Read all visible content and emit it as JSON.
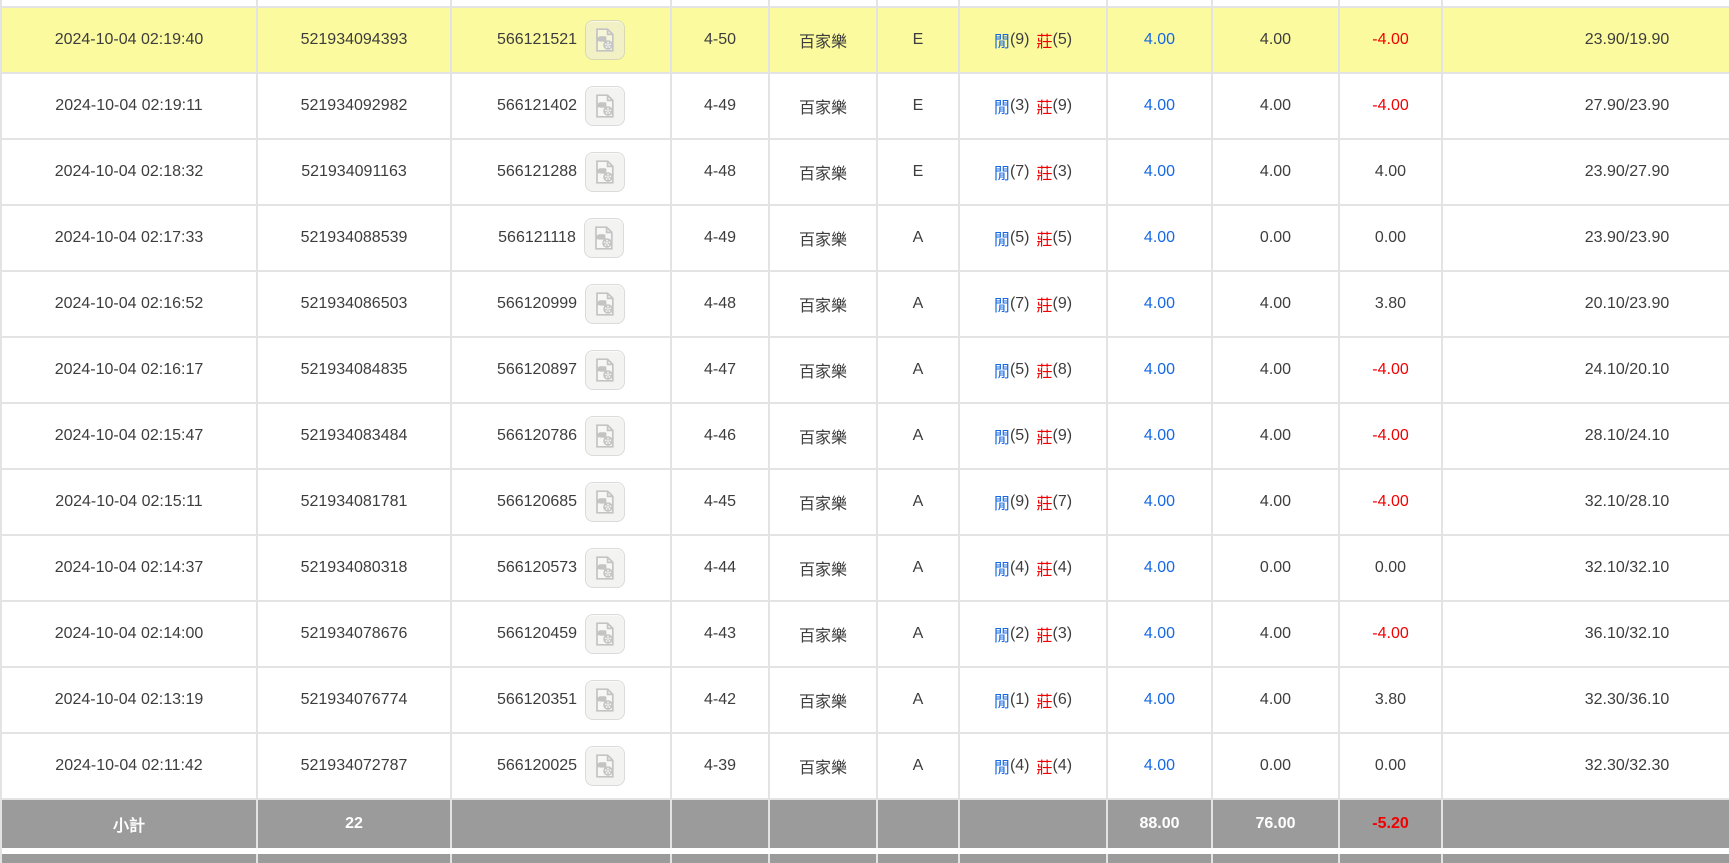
{
  "colors": {
    "highlight_row": "#fbfa9e",
    "summary_bar": "#9b9b9b",
    "bet_amount_blue": "#1668e3",
    "negative_red": "#f20000",
    "grid_border": "#e3e3e3",
    "text": "#3d3d3d"
  },
  "labels": {
    "player": "閒",
    "banker": "莊",
    "game_baccarat": "百家樂",
    "video_icon": "video-replay-icon"
  },
  "table": {
    "rows": [
      {
        "time": "2024-10-04 02:19:40",
        "bet_id": "521934094393",
        "game_id": "566121521",
        "round": "4-50",
        "game": "百家樂",
        "table": "E",
        "player_score": "(9)",
        "banker_score": "(5)",
        "bet": "4.00",
        "valid": "4.00",
        "win_loss": "-4.00",
        "balance": "23.90/19.90",
        "highlight": true
      },
      {
        "time": "2024-10-04 02:19:11",
        "bet_id": "521934092982",
        "game_id": "566121402",
        "round": "4-49",
        "game": "百家樂",
        "table": "E",
        "player_score": "(3)",
        "banker_score": "(9)",
        "bet": "4.00",
        "valid": "4.00",
        "win_loss": "-4.00",
        "balance": "27.90/23.90",
        "highlight": false
      },
      {
        "time": "2024-10-04 02:18:32",
        "bet_id": "521934091163",
        "game_id": "566121288",
        "round": "4-48",
        "game": "百家樂",
        "table": "E",
        "player_score": "(7)",
        "banker_score": "(3)",
        "bet": "4.00",
        "valid": "4.00",
        "win_loss": "4.00",
        "balance": "23.90/27.90",
        "highlight": false
      },
      {
        "time": "2024-10-04 02:17:33",
        "bet_id": "521934088539",
        "game_id": "566121118",
        "round": "4-49",
        "game": "百家樂",
        "table": "A",
        "player_score": "(5)",
        "banker_score": "(5)",
        "bet": "4.00",
        "valid": "0.00",
        "win_loss": "0.00",
        "balance": "23.90/23.90",
        "highlight": false
      },
      {
        "time": "2024-10-04 02:16:52",
        "bet_id": "521934086503",
        "game_id": "566120999",
        "round": "4-48",
        "game": "百家樂",
        "table": "A",
        "player_score": "(7)",
        "banker_score": "(9)",
        "bet": "4.00",
        "valid": "4.00",
        "win_loss": "3.80",
        "balance": "20.10/23.90",
        "highlight": false
      },
      {
        "time": "2024-10-04 02:16:17",
        "bet_id": "521934084835",
        "game_id": "566120897",
        "round": "4-47",
        "game": "百家樂",
        "table": "A",
        "player_score": "(5)",
        "banker_score": "(8)",
        "bet": "4.00",
        "valid": "4.00",
        "win_loss": "-4.00",
        "balance": "24.10/20.10",
        "highlight": false
      },
      {
        "time": "2024-10-04 02:15:47",
        "bet_id": "521934083484",
        "game_id": "566120786",
        "round": "4-46",
        "game": "百家樂",
        "table": "A",
        "player_score": "(5)",
        "banker_score": "(9)",
        "bet": "4.00",
        "valid": "4.00",
        "win_loss": "-4.00",
        "balance": "28.10/24.10",
        "highlight": false
      },
      {
        "time": "2024-10-04 02:15:11",
        "bet_id": "521934081781",
        "game_id": "566120685",
        "round": "4-45",
        "game": "百家樂",
        "table": "A",
        "player_score": "(9)",
        "banker_score": "(7)",
        "bet": "4.00",
        "valid": "4.00",
        "win_loss": "-4.00",
        "balance": "32.10/28.10",
        "highlight": false
      },
      {
        "time": "2024-10-04 02:14:37",
        "bet_id": "521934080318",
        "game_id": "566120573",
        "round": "4-44",
        "game": "百家樂",
        "table": "A",
        "player_score": "(4)",
        "banker_score": "(4)",
        "bet": "4.00",
        "valid": "0.00",
        "win_loss": "0.00",
        "balance": "32.10/32.10",
        "highlight": false
      },
      {
        "time": "2024-10-04 02:14:00",
        "bet_id": "521934078676",
        "game_id": "566120459",
        "round": "4-43",
        "game": "百家樂",
        "table": "A",
        "player_score": "(2)",
        "banker_score": "(3)",
        "bet": "4.00",
        "valid": "4.00",
        "win_loss": "-4.00",
        "balance": "36.10/32.10",
        "highlight": false
      },
      {
        "time": "2024-10-04 02:13:19",
        "bet_id": "521934076774",
        "game_id": "566120351",
        "round": "4-42",
        "game": "百家樂",
        "table": "A",
        "player_score": "(1)",
        "banker_score": "(6)",
        "bet": "4.00",
        "valid": "4.00",
        "win_loss": "3.80",
        "balance": "32.30/36.10",
        "highlight": false
      },
      {
        "time": "2024-10-04 02:11:42",
        "bet_id": "521934072787",
        "game_id": "566120025",
        "round": "4-39",
        "game": "百家樂",
        "table": "A",
        "player_score": "(4)",
        "banker_score": "(4)",
        "bet": "4.00",
        "valid": "0.00",
        "win_loss": "0.00",
        "balance": "32.30/32.30",
        "highlight": false
      }
    ],
    "subtotal": {
      "label": "小計",
      "count": "22",
      "bet_total": "88.00",
      "valid_total": "76.00",
      "win_loss_total": "-5.20"
    }
  }
}
